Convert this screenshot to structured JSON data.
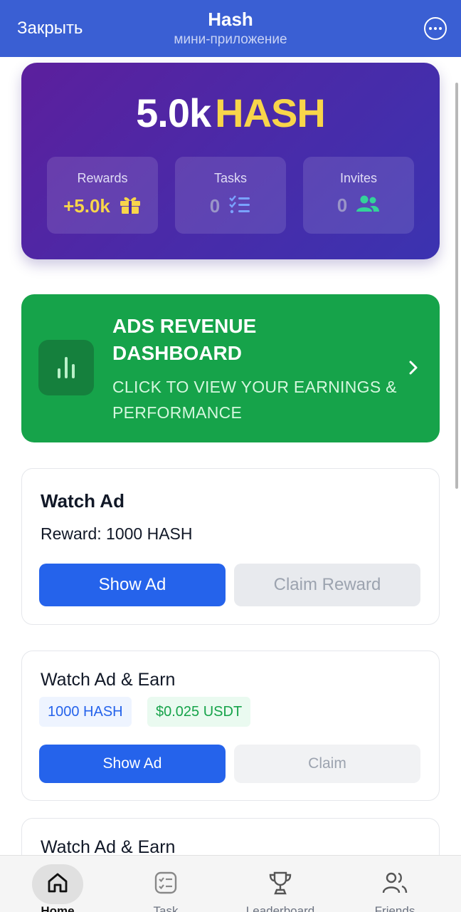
{
  "header": {
    "close_label": "Закрыть",
    "title": "Hash",
    "subtitle": "мини-приложение"
  },
  "balance": {
    "amount": "5.0k",
    "unit": "HASH",
    "stats": [
      {
        "label": "Rewards",
        "value": "+5.0k",
        "icon": "gift-icon"
      },
      {
        "label": "Tasks",
        "value": "0",
        "icon": "checklist-icon"
      },
      {
        "label": "Invites",
        "value": "0",
        "icon": "users-icon"
      }
    ]
  },
  "banner": {
    "title": "ADS REVENUE DASHBOARD",
    "subtitle": "CLICK TO VIEW YOUR EARNINGS & PERFORMANCE",
    "icon": "bar-chart-icon"
  },
  "ad_cards": [
    {
      "title": "Watch Ad",
      "reward": "Reward: 1000 HASH",
      "primary": "Show Ad",
      "secondary": "Claim Reward"
    },
    {
      "title": "Watch Ad & Earn",
      "chip_hash": "1000 HASH",
      "chip_usdt": "$0.025 USDT",
      "primary": "Show Ad",
      "secondary": "Claim"
    },
    {
      "title": "Watch Ad & Earn"
    }
  ],
  "nav": {
    "items": [
      {
        "label": "Home",
        "icon": "home-icon",
        "active": true
      },
      {
        "label": "Task",
        "icon": "task-icon"
      },
      {
        "label": "Leaderboard",
        "icon": "trophy-icon"
      },
      {
        "label": "Friends",
        "icon": "friends-icon"
      }
    ]
  },
  "colors": {
    "header": "#3a5fd3",
    "accent_gold": "#f8d54a",
    "banner_green": "#16a34a",
    "primary_blue": "#2563eb"
  }
}
